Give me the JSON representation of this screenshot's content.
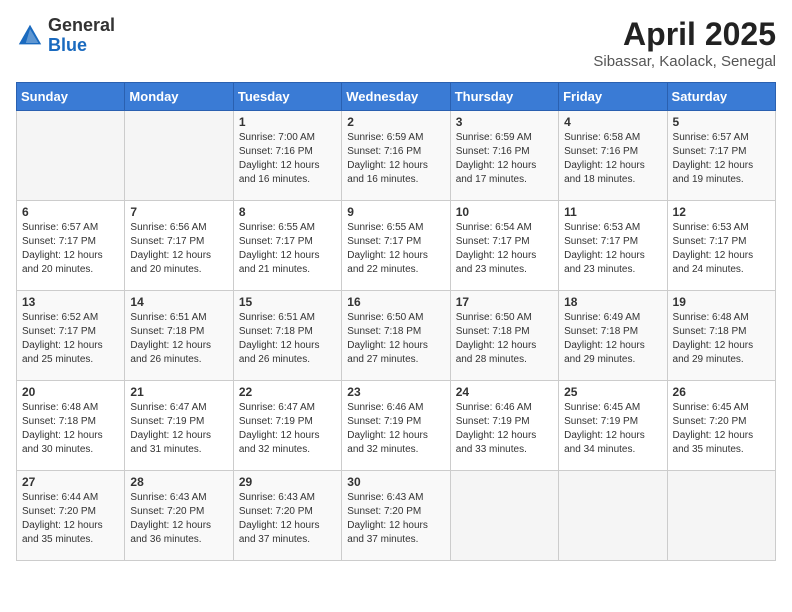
{
  "header": {
    "logo_general": "General",
    "logo_blue": "Blue",
    "title": "April 2025",
    "subtitle": "Sibassar, Kaolack, Senegal"
  },
  "calendar": {
    "days_of_week": [
      "Sunday",
      "Monday",
      "Tuesday",
      "Wednesday",
      "Thursday",
      "Friday",
      "Saturday"
    ],
    "weeks": [
      [
        {
          "day": "",
          "info": ""
        },
        {
          "day": "",
          "info": ""
        },
        {
          "day": "1",
          "info": "Sunrise: 7:00 AM\nSunset: 7:16 PM\nDaylight: 12 hours and 16 minutes."
        },
        {
          "day": "2",
          "info": "Sunrise: 6:59 AM\nSunset: 7:16 PM\nDaylight: 12 hours and 16 minutes."
        },
        {
          "day": "3",
          "info": "Sunrise: 6:59 AM\nSunset: 7:16 PM\nDaylight: 12 hours and 17 minutes."
        },
        {
          "day": "4",
          "info": "Sunrise: 6:58 AM\nSunset: 7:16 PM\nDaylight: 12 hours and 18 minutes."
        },
        {
          "day": "5",
          "info": "Sunrise: 6:57 AM\nSunset: 7:17 PM\nDaylight: 12 hours and 19 minutes."
        }
      ],
      [
        {
          "day": "6",
          "info": "Sunrise: 6:57 AM\nSunset: 7:17 PM\nDaylight: 12 hours and 20 minutes."
        },
        {
          "day": "7",
          "info": "Sunrise: 6:56 AM\nSunset: 7:17 PM\nDaylight: 12 hours and 20 minutes."
        },
        {
          "day": "8",
          "info": "Sunrise: 6:55 AM\nSunset: 7:17 PM\nDaylight: 12 hours and 21 minutes."
        },
        {
          "day": "9",
          "info": "Sunrise: 6:55 AM\nSunset: 7:17 PM\nDaylight: 12 hours and 22 minutes."
        },
        {
          "day": "10",
          "info": "Sunrise: 6:54 AM\nSunset: 7:17 PM\nDaylight: 12 hours and 23 minutes."
        },
        {
          "day": "11",
          "info": "Sunrise: 6:53 AM\nSunset: 7:17 PM\nDaylight: 12 hours and 23 minutes."
        },
        {
          "day": "12",
          "info": "Sunrise: 6:53 AM\nSunset: 7:17 PM\nDaylight: 12 hours and 24 minutes."
        }
      ],
      [
        {
          "day": "13",
          "info": "Sunrise: 6:52 AM\nSunset: 7:17 PM\nDaylight: 12 hours and 25 minutes."
        },
        {
          "day": "14",
          "info": "Sunrise: 6:51 AM\nSunset: 7:18 PM\nDaylight: 12 hours and 26 minutes."
        },
        {
          "day": "15",
          "info": "Sunrise: 6:51 AM\nSunset: 7:18 PM\nDaylight: 12 hours and 26 minutes."
        },
        {
          "day": "16",
          "info": "Sunrise: 6:50 AM\nSunset: 7:18 PM\nDaylight: 12 hours and 27 minutes."
        },
        {
          "day": "17",
          "info": "Sunrise: 6:50 AM\nSunset: 7:18 PM\nDaylight: 12 hours and 28 minutes."
        },
        {
          "day": "18",
          "info": "Sunrise: 6:49 AM\nSunset: 7:18 PM\nDaylight: 12 hours and 29 minutes."
        },
        {
          "day": "19",
          "info": "Sunrise: 6:48 AM\nSunset: 7:18 PM\nDaylight: 12 hours and 29 minutes."
        }
      ],
      [
        {
          "day": "20",
          "info": "Sunrise: 6:48 AM\nSunset: 7:18 PM\nDaylight: 12 hours and 30 minutes."
        },
        {
          "day": "21",
          "info": "Sunrise: 6:47 AM\nSunset: 7:19 PM\nDaylight: 12 hours and 31 minutes."
        },
        {
          "day": "22",
          "info": "Sunrise: 6:47 AM\nSunset: 7:19 PM\nDaylight: 12 hours and 32 minutes."
        },
        {
          "day": "23",
          "info": "Sunrise: 6:46 AM\nSunset: 7:19 PM\nDaylight: 12 hours and 32 minutes."
        },
        {
          "day": "24",
          "info": "Sunrise: 6:46 AM\nSunset: 7:19 PM\nDaylight: 12 hours and 33 minutes."
        },
        {
          "day": "25",
          "info": "Sunrise: 6:45 AM\nSunset: 7:19 PM\nDaylight: 12 hours and 34 minutes."
        },
        {
          "day": "26",
          "info": "Sunrise: 6:45 AM\nSunset: 7:20 PM\nDaylight: 12 hours and 35 minutes."
        }
      ],
      [
        {
          "day": "27",
          "info": "Sunrise: 6:44 AM\nSunset: 7:20 PM\nDaylight: 12 hours and 35 minutes."
        },
        {
          "day": "28",
          "info": "Sunrise: 6:43 AM\nSunset: 7:20 PM\nDaylight: 12 hours and 36 minutes."
        },
        {
          "day": "29",
          "info": "Sunrise: 6:43 AM\nSunset: 7:20 PM\nDaylight: 12 hours and 37 minutes."
        },
        {
          "day": "30",
          "info": "Sunrise: 6:43 AM\nSunset: 7:20 PM\nDaylight: 12 hours and 37 minutes."
        },
        {
          "day": "",
          "info": ""
        },
        {
          "day": "",
          "info": ""
        },
        {
          "day": "",
          "info": ""
        }
      ]
    ]
  }
}
